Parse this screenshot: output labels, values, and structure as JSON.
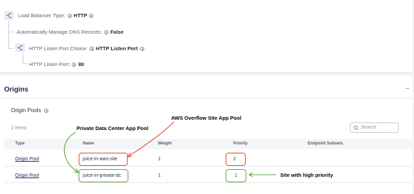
{
  "config": {
    "lb_type_label": "Load Balancer Type:",
    "lb_type_value": "HTTP",
    "dns_label": "Automatically Manage DNS Records:",
    "dns_value": "False",
    "listen_choice_label": "HTTP Listen Port Choice:",
    "listen_choice_value": "HTTP Listen Port",
    "listen_port_label": "HTTP Listen Port:",
    "listen_port_value": "80"
  },
  "origins": {
    "title": "Origins",
    "pools_title": "Origin Pools",
    "item_count": "2 items",
    "search_placeholder": "Search",
    "columns": [
      "Type",
      "Name",
      "Weight",
      "Priority",
      "Endpoint Subsets"
    ],
    "rows": [
      {
        "type": "Origin Pool",
        "name": "juice-in-aws-site",
        "weight": "1",
        "priority": "2"
      },
      {
        "type": "Origin Pool",
        "name": "juice-in-private-dc",
        "weight": "1",
        "priority": "1"
      }
    ]
  },
  "annotations": {
    "private_dc": "Private Data Center App Pool",
    "aws_overflow": "AWS Overflow Site App Pool",
    "high_priority": "Site with high priority"
  },
  "colors": {
    "red": "#e8461f",
    "green": "#5fa63c",
    "link": "#1b2556"
  }
}
